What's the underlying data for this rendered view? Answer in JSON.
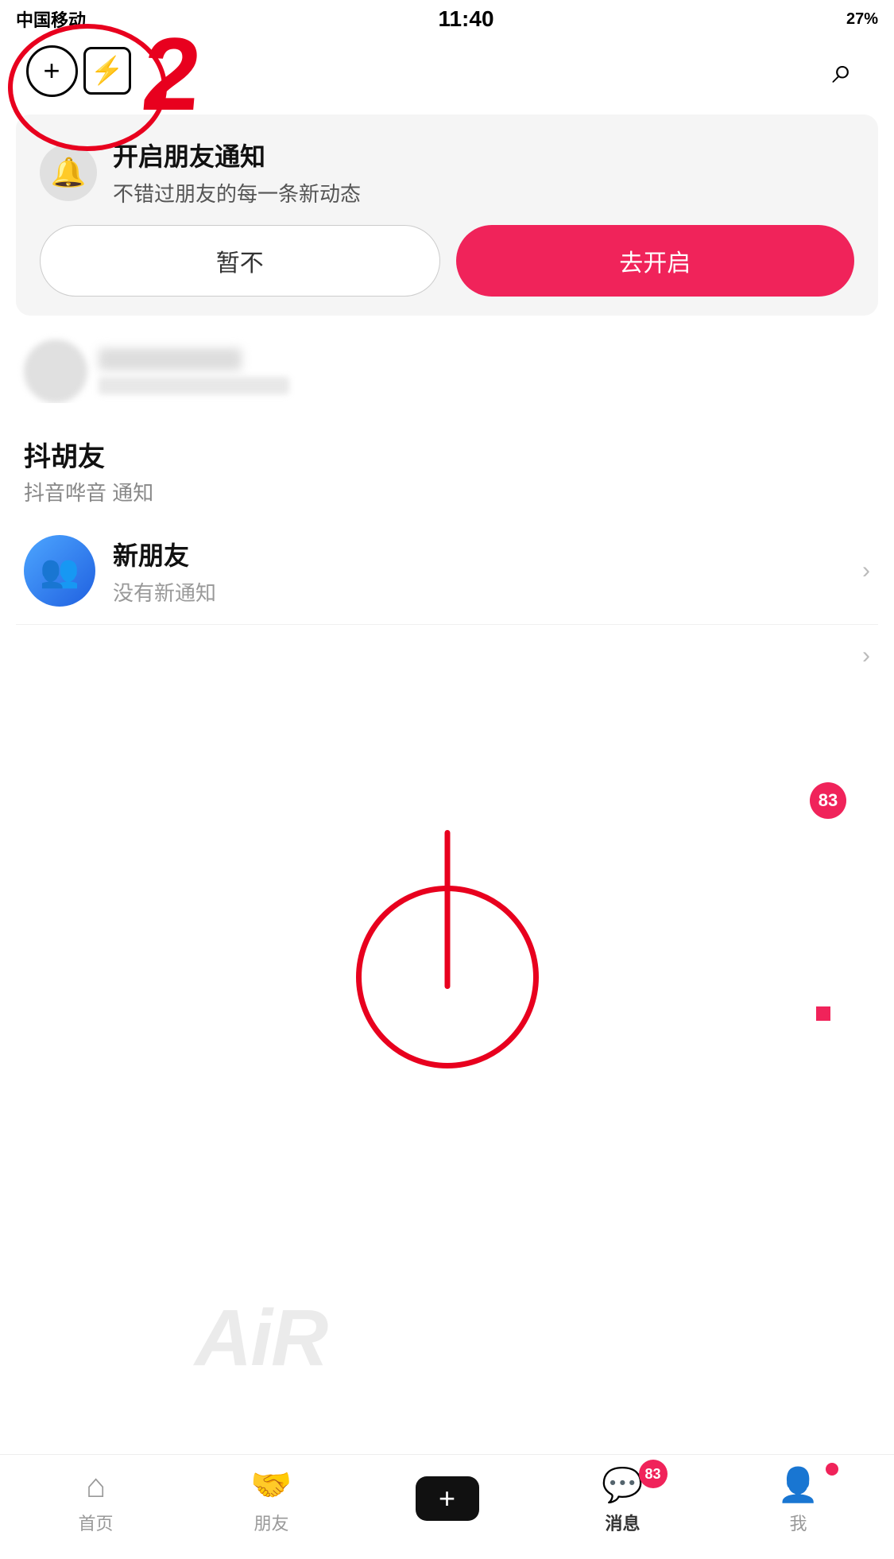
{
  "status": {
    "carrier": "中国移动",
    "time": "11:40",
    "battery": "27%"
  },
  "nav": {
    "add_label": "+",
    "lightning_label": "⚡",
    "search_label": "🔍"
  },
  "notification": {
    "icon": "🔔",
    "title": "开启朋友通知",
    "desc": "不错过朋友的每一条新动态",
    "cancel_label": "暂不",
    "confirm_label": "去开启"
  },
  "douhuyou": {
    "name": "抖胡友",
    "notice_text": "抖音哗音 通知"
  },
  "new_friends": {
    "title": "新朋友",
    "subtitle": "没有新通知"
  },
  "badge_count": "83",
  "bottom_nav": {
    "home_label": "首页",
    "friends_label": "朋友",
    "add_label": "+",
    "messages_label": "消息",
    "me_label": "我",
    "messages_badge": "83"
  },
  "annotations": {
    "red_number": "2"
  },
  "air_text": "AiR"
}
